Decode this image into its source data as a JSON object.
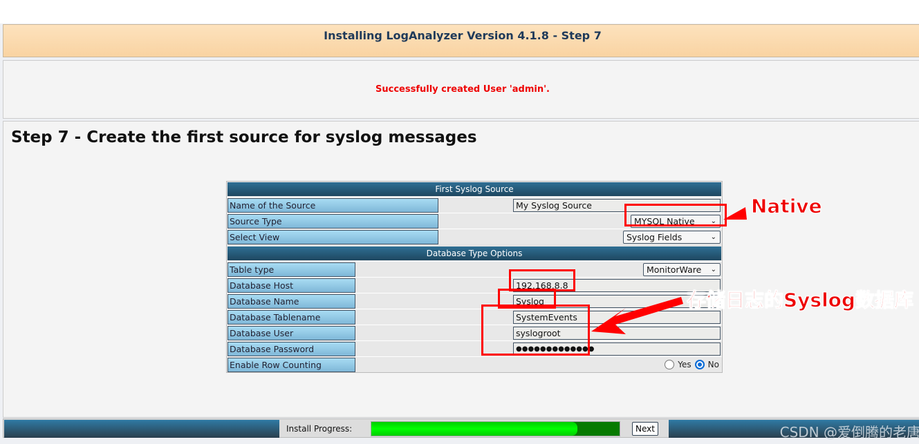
{
  "header": {
    "title": "Installing LogAnalyzer Version 4.1.8 - Step 7"
  },
  "message": "Successfully created User 'admin'.",
  "page_title": "Step 7 - Create the first source for syslog messages",
  "source": {
    "section": "First Syslog Source",
    "name_label": "Name of the Source",
    "name_value": "My Syslog Source",
    "type_label": "Source Type",
    "type_value": "MYSQL Native",
    "view_label": "Select View",
    "view_value": "Syslog Fields"
  },
  "db": {
    "section": "Database Type Options",
    "table_type_label": "Table type",
    "table_type_value": "MonitorWare",
    "host_label": "Database Host",
    "host_value": "192.168.8.8",
    "name_label": "Database Name",
    "name_value": "Syslog",
    "tablename_label": "Database Tablename",
    "tablename_value": "SystemEvents",
    "user_label": "Database User",
    "user_value": "syslogroot",
    "password_label": "Database Password",
    "password_value": "●●●●●●●●●●●●●",
    "rowcount_label": "Enable Row Counting",
    "yes_label": "Yes",
    "no_label": "No",
    "rowcount_selected": "No"
  },
  "footer": {
    "progress_label": "Install Progress:",
    "progress_fraction": 0.83,
    "next_label": "Next"
  },
  "watermark": "CSDN @爱倒腾的老唐",
  "annotations": {
    "native": "Native",
    "db_note": "存储日志的Syslog数据库"
  }
}
